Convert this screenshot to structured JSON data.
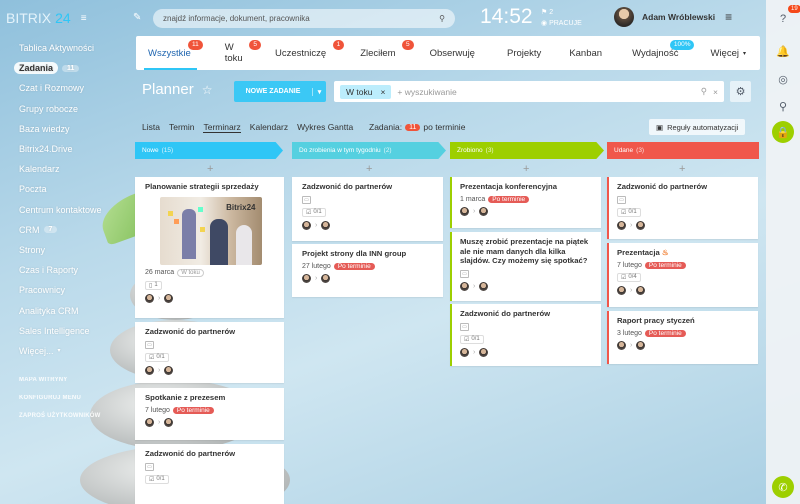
{
  "header": {
    "logo_text": "BITRIX",
    "logo_num": "24",
    "search_placeholder": "znajdź informacje, dokument, pracownika",
    "time": "14:52",
    "flag_count": "2",
    "work_status": "PRACUJE",
    "user_name": "Adam Wróblewski"
  },
  "right_panel": {
    "notif_count": "19"
  },
  "sidebar": {
    "items": [
      {
        "label": "Tablica Aktywności"
      },
      {
        "label": "Zadania",
        "count": "11"
      },
      {
        "label": "Czat i Rozmowy"
      },
      {
        "label": "Grupy robocze"
      },
      {
        "label": "Baza wiedzy"
      },
      {
        "label": "Bitrix24.Drive"
      },
      {
        "label": "Kalendarz"
      },
      {
        "label": "Poczta"
      },
      {
        "label": "Centrum kontaktowe"
      },
      {
        "label": "CRM",
        "count": "7"
      },
      {
        "label": "Strony"
      },
      {
        "label": "Czas i Raporty"
      },
      {
        "label": "Pracownicy"
      },
      {
        "label": "Analityka CRM"
      },
      {
        "label": "Sales Intelligence"
      },
      {
        "label": "Więcej..."
      }
    ],
    "footer": [
      "MAPA WITRYNY",
      "KONFIGURUJ MENU",
      "ZAPROŚ UŻYTKOWNIKÓW"
    ]
  },
  "tabs": [
    {
      "label": "Wszystkie",
      "badge": "11"
    },
    {
      "label": "W toku",
      "badge": "5"
    },
    {
      "label": "Uczestniczę",
      "badge": "1"
    },
    {
      "label": "Zleciłem",
      "badge": "5"
    },
    {
      "label": "Obserwuję",
      "badge": ""
    },
    {
      "label": "Projekty",
      "badge": ""
    },
    {
      "label": "Kanban",
      "badge": ""
    },
    {
      "label": "Wydajność",
      "badge": "100%"
    },
    {
      "label": "Więcej",
      "badge": ""
    }
  ],
  "planner": {
    "title": "Planner",
    "new_task": "NOWE ZADANIE",
    "filter_chip": "W toku",
    "search_placeholder": "+ wyszukiwanie",
    "views": [
      "Lista",
      "Termin",
      "Terminarz",
      "Kalendarz",
      "Wykres Gantta"
    ],
    "tasks_label": "Zadania:",
    "tasks_count": "11",
    "tasks_suffix": "po terminie",
    "automation": "Reguły automatyzacji"
  },
  "columns": [
    {
      "title": "Nowe",
      "count": "(15)",
      "color": "#2fc6f6"
    },
    {
      "title": "Do zrobienia w tym tygodniu",
      "count": "(2)",
      "color": "#55d0e0"
    },
    {
      "title": "Zrobiono",
      "count": "(3)",
      "color": "#9dcf00"
    },
    {
      "title": "Udane",
      "count": "(3)",
      "color": "#f0574b"
    }
  ],
  "cards": {
    "c1": {
      "title": "Planowanie strategii sprzedaży",
      "image_label": "Bitrix24",
      "date": "26 marca",
      "status": "W toku",
      "checklist": "1"
    },
    "c2": {
      "title": "Zadzwonić do partnerów",
      "checklist": "0/1"
    },
    "c3": {
      "title": "Spotkanie z prezesem",
      "date": "7 lutego",
      "overdue": "Po terminie"
    },
    "c4": {
      "title": "Zadzwonić do partnerów",
      "checklist": "0/1"
    },
    "d1": {
      "title": "Zadzwonić do partnerów",
      "checklist": "0/1"
    },
    "d2": {
      "title": "Projekt strony dla INN group",
      "date": "27 lutego",
      "overdue": "Po terminie"
    },
    "z1": {
      "title": "Prezentacja konferencyjna",
      "date": "1 marca",
      "overdue": "Po terminie"
    },
    "z2": {
      "title": "Muszę zrobić prezentacje na piątek ale nie mam danych dla kilka slajdów. Czy możemy się spotkać?"
    },
    "z3": {
      "title": "Zadzwonić do partnerów",
      "checklist": "0/1"
    },
    "u1": {
      "title": "Zadzwonić do partnerów",
      "checklist": "0/1"
    },
    "u2": {
      "title": "Prezentacja",
      "date": "7 lutego",
      "overdue": "Po terminie",
      "checklist": "0/4"
    },
    "u3": {
      "title": "Raport pracy styczeń",
      "date": "3 lutego",
      "overdue": "Po terminie"
    }
  }
}
